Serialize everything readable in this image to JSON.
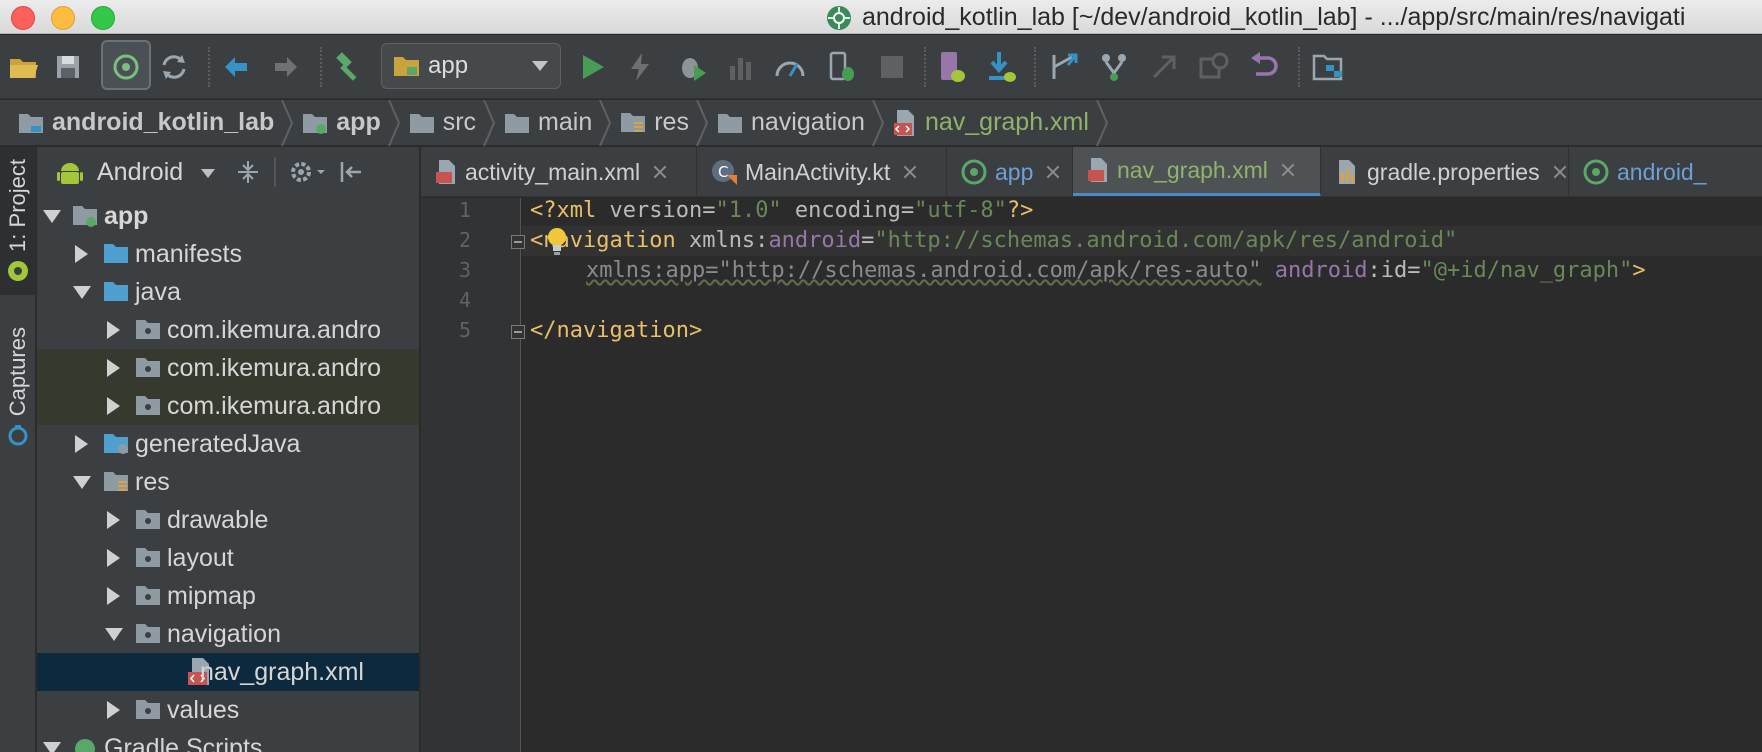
{
  "window": {
    "title": "android_kotlin_lab [~/dev/android_kotlin_lab] - .../app/src/main/res/navigati"
  },
  "toolbar": {
    "run_config": "app",
    "icons": [
      "open-folder-icon",
      "save-icon",
      "sync-icon",
      "sync-project-icon",
      "back-icon",
      "forward-icon",
      "build-hammer-icon",
      "run-icon",
      "apply-changes-icon",
      "debug-icon",
      "profile-icon",
      "profiler-gauge-icon",
      "attach-debugger-icon",
      "stop-icon",
      "avd-manager-icon",
      "sdk-manager-icon",
      "vcs-update-icon",
      "vcs-branch-icon",
      "vcs-push-icon",
      "history-icon",
      "revert-icon",
      "project-structure-icon"
    ]
  },
  "breadcrumb": {
    "items": [
      "android_kotlin_lab",
      "app",
      "src",
      "main",
      "res",
      "navigation",
      "nav_graph.xml"
    ]
  },
  "sidebar_strip": {
    "project_tab": "1: Project",
    "captures_tab": "Captures"
  },
  "project_panel": {
    "view_mode": "Android",
    "tree": [
      {
        "label": "app",
        "expanded": true
      },
      {
        "label": "manifests",
        "expanded": false
      },
      {
        "label": "java",
        "expanded": true
      },
      {
        "label": "com.ikemura.andro",
        "expanded": false
      },
      {
        "label": "com.ikemura.andro",
        "expanded": false
      },
      {
        "label": "com.ikemura.andro",
        "expanded": false
      },
      {
        "label": "generatedJava",
        "expanded": false
      },
      {
        "label": "res",
        "expanded": true
      },
      {
        "label": "drawable",
        "expanded": false
      },
      {
        "label": "layout",
        "expanded": false
      },
      {
        "label": "mipmap",
        "expanded": false
      },
      {
        "label": "navigation",
        "expanded": true
      },
      {
        "label": "nav_graph.xml",
        "selected": true
      },
      {
        "label": "values",
        "expanded": false
      },
      {
        "label": "Gradle Scripts",
        "expanded": true
      }
    ]
  },
  "tabs": [
    {
      "label": "activity_main.xml"
    },
    {
      "label": "MainActivity.kt"
    },
    {
      "label": "app"
    },
    {
      "label": "nav_graph.xml",
      "active": true
    },
    {
      "label": "gradle.properties"
    },
    {
      "label": "android_"
    }
  ],
  "editor": {
    "line_numbers": [
      "1",
      "2",
      "3",
      "4",
      "5"
    ],
    "line1": {
      "open": "<?xml ",
      "a1": "version",
      "eq1": "=",
      "v1": "\"1.0\"",
      "a2": " encoding",
      "eq2": "=",
      "v2": "\"utf-8\"",
      "close": "?>"
    },
    "line2": {
      "open": "<navigation ",
      "a1": "xmlns:",
      "ns1": "android",
      "eq1": "=",
      "v1": "\"http://schemas.android.com/apk/res/android\""
    },
    "line3": {
      "dim": "xmlns:app=\"http://schemas.android.com/apk/res-auto\"",
      "ns2": " android",
      "a2": ":id",
      "eq2": "=",
      "v2": "\"@+id/nav_graph\"",
      "close": ">"
    },
    "line5": {
      "close_tag": "</navigation>"
    }
  },
  "colors": {
    "background": "#2b2b2b",
    "panel": "#3c3f41",
    "selection": "#0d293e",
    "accent_green": "#8fb36b",
    "tab_underline": "#4a88c7"
  }
}
